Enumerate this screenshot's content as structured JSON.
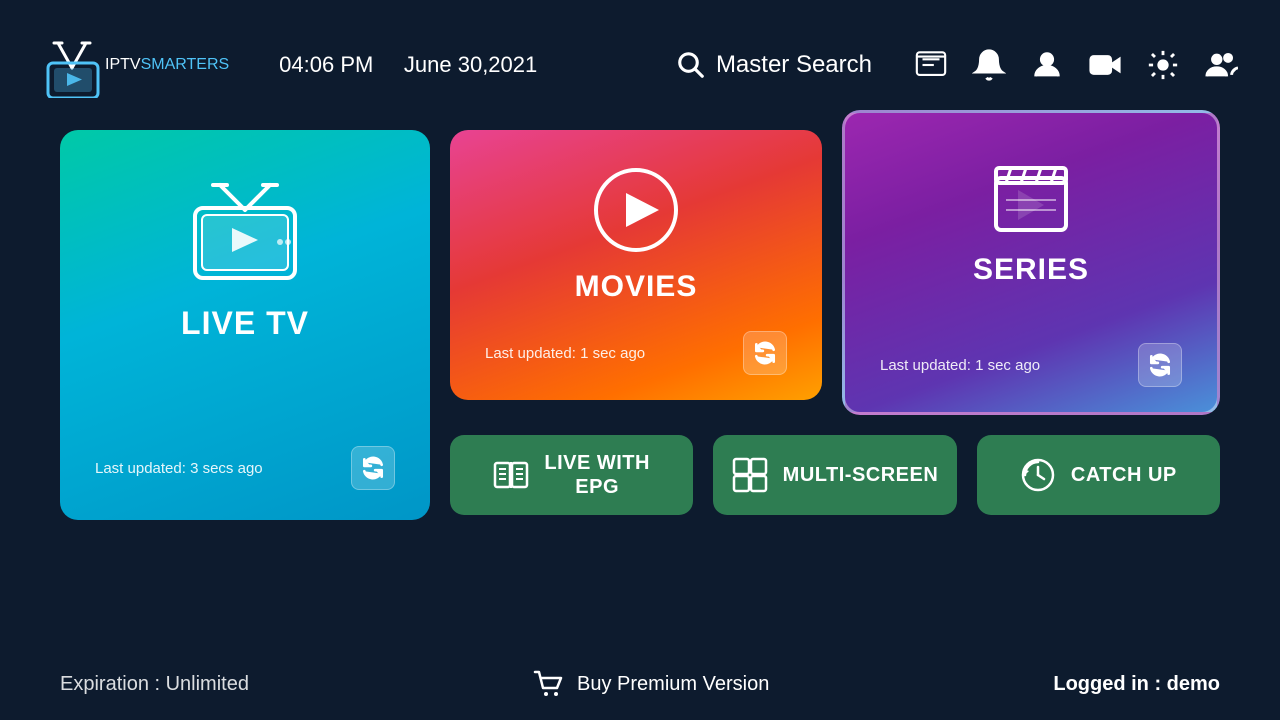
{
  "header": {
    "logo_iptv": "IPTV",
    "logo_smarters": "SMARTERS",
    "time": "04:06 PM",
    "date": "June 30,2021",
    "search_label": "Master Search"
  },
  "cards": {
    "live_tv": {
      "title": "LIVE TV",
      "last_updated": "Last updated: 3 secs ago"
    },
    "movies": {
      "title": "MOVIES",
      "last_updated": "Last updated: 1 sec ago"
    },
    "series": {
      "title": "SERIES",
      "last_updated": "Last updated: 1 sec ago"
    }
  },
  "buttons": {
    "live_epg": "LIVE WITH\nEPG",
    "live_epg_line1": "LIVE WITH",
    "live_epg_line2": "EPG",
    "multi_screen": "MULTI-SCREEN",
    "catch_up": "CATCH UP"
  },
  "footer": {
    "expiration": "Expiration : Unlimited",
    "buy_premium": "Buy Premium Version",
    "logged_in_label": "Logged in : ",
    "logged_in_user": "demo"
  }
}
